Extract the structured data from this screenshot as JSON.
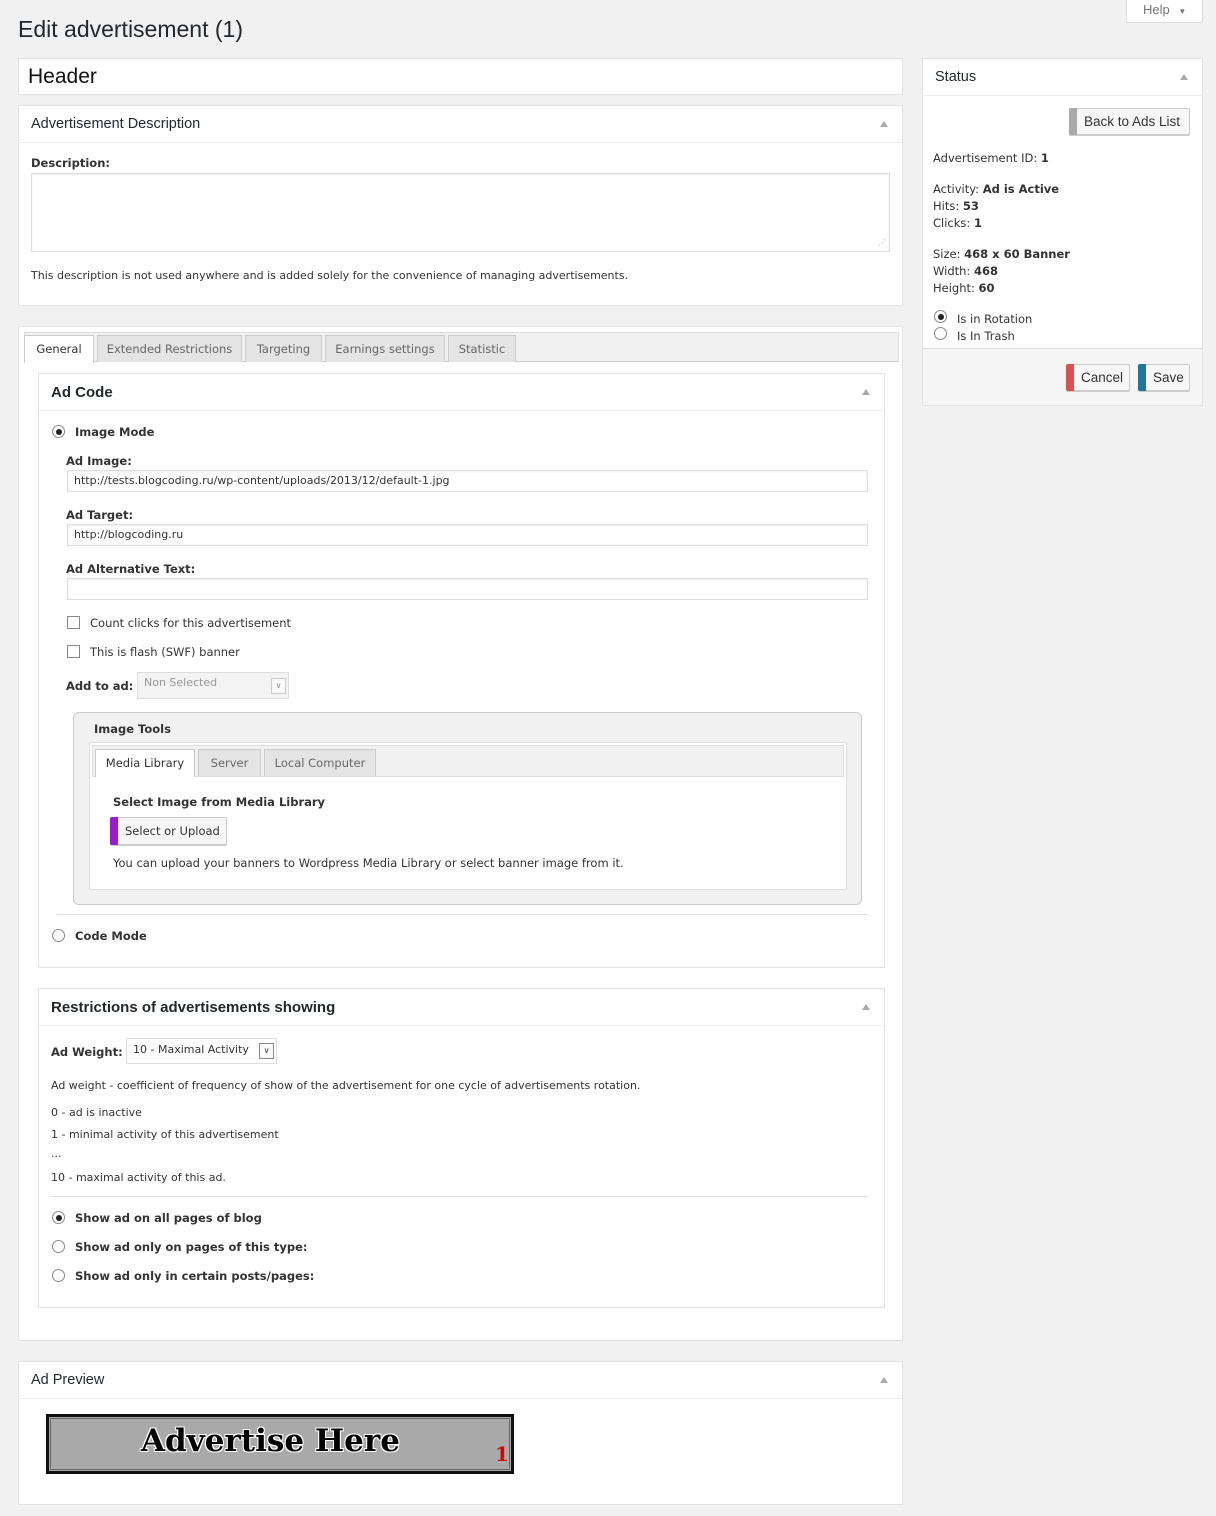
{
  "page": {
    "title": "Edit advertisement (1)",
    "help": "Help"
  },
  "header_input": {
    "value": "Header"
  },
  "description_box": {
    "title": "Advertisement Description",
    "label": "Description:",
    "value": "",
    "note": "This description is not used anywhere and is added solely for the convenience of managing advertisements."
  },
  "tabs": [
    "General",
    "Extended Restrictions",
    "Targeting",
    "Earnings settings",
    "Statistic"
  ],
  "ad_code": {
    "title": "Ad Code",
    "image_mode": "Image Mode",
    "ad_image_label": "Ad Image:",
    "ad_image_value": "http://tests.blogcoding.ru/wp-content/uploads/2013/12/default-1.jpg",
    "ad_target_label": "Ad Target:",
    "ad_target_value": "http://blogcoding.ru",
    "alt_text_label": "Ad Alternative Text:",
    "alt_text_value": "",
    "count_clicks": "Count clicks for this advertisement",
    "flash_banner": "This is flash (SWF) banner",
    "add_to_ad_label": "Add to ad:",
    "add_to_ad_value": "Non Selected",
    "image_tools": {
      "title": "Image Tools",
      "tabs": [
        "Media Library",
        "Server",
        "Local Computer"
      ],
      "select_title": "Select Image from Media Library",
      "select_button": "Select or Upload",
      "note": "You can upload your banners to Wordpress Media Library or select banner image from it."
    },
    "code_mode": "Code Mode"
  },
  "restrictions": {
    "title": "Restrictions of advertisements showing",
    "weight_label": "Ad Weight:",
    "weight_value": "10 - Maximal Activity",
    "weight_desc": "Ad weight - coefficient of frequency of show of the advertisement for one cycle of advertisements rotation.",
    "weight_lines": [
      "0 - ad is inactive",
      "1 - minimal activity of this advertisement",
      "...",
      "10 - maximal activity of this ad."
    ],
    "options": [
      "Show ad on all pages of blog",
      "Show ad only on pages of this type:",
      "Show ad only in certain posts/pages:"
    ]
  },
  "preview": {
    "title": "Ad Preview",
    "banner_text": "Advertise Here",
    "banner_num": "1"
  },
  "status": {
    "title": "Status",
    "back_button": "Back to Ads List",
    "id_label": "Advertisement ID:",
    "id_value": "1",
    "activity_label": "Activity:",
    "activity_value": "Ad is Active",
    "hits_label": "Hits:",
    "hits_value": "53",
    "clicks_label": "Clicks:",
    "clicks_value": "1",
    "size_label": "Size:",
    "size_value": "468 x 60 Banner",
    "width_label": "Width:",
    "width_value": "468",
    "height_label": "Height:",
    "height_value": "60",
    "rotation": "Is in Rotation",
    "trash": "Is In Trash",
    "cancel": "Cancel",
    "save": "Save"
  },
  "colors": {
    "cancel_accent": "#d9534f",
    "save_accent": "#21759b",
    "upload_accent": "#9b1bd1"
  }
}
